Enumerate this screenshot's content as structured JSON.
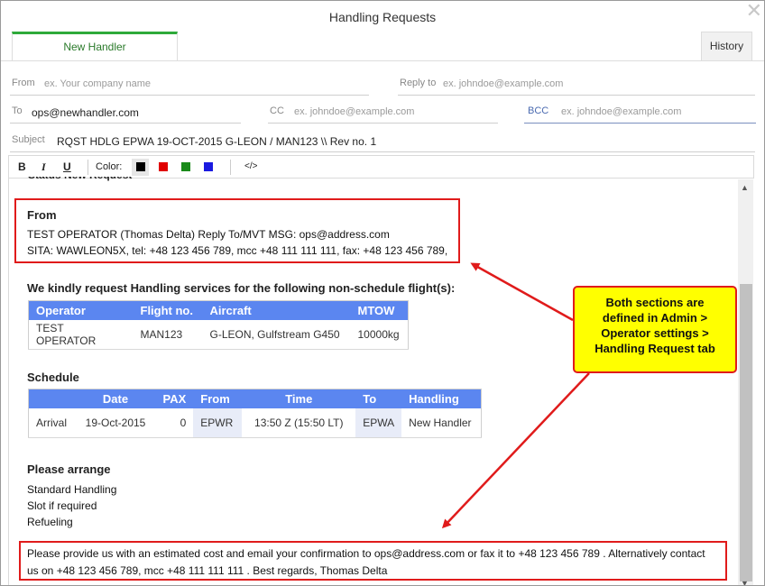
{
  "window": {
    "title": "Handling Requests"
  },
  "tabs": {
    "new_handler": "New Handler",
    "history": "History"
  },
  "form": {
    "from": {
      "label": "From",
      "placeholder": "ex. Your company name"
    },
    "reply_to": {
      "label": "Reply to",
      "placeholder": "ex. johndoe@example.com"
    },
    "to": {
      "label": "To",
      "value": "ops@newhandler.com"
    },
    "cc": {
      "label": "CC",
      "placeholder": "ex. johndoe@example.com"
    },
    "bcc": {
      "label": "BCC",
      "placeholder": "ex. johndoe@example.com"
    },
    "subject": {
      "label": "Subject",
      "value": "RQST HDLG  EPWA 19-OCT-2015  G-LEON / MAN123 \\\\ Rev no. 1"
    }
  },
  "toolbar": {
    "bold": "B",
    "italic": "I",
    "underline": "U",
    "color_label": "Color:",
    "source": "</>",
    "colors": [
      "#000000",
      "#e00000",
      "#1a8a1a",
      "#1a1ae0"
    ]
  },
  "body": {
    "cut_line": "Status New Request",
    "from_title": "From",
    "from_line1": "TEST OPERATOR (Thomas Delta) Reply To/MVT MSG: ops@address.com",
    "from_line2": "SITA: WAWLEON5X, tel: +48 123 456 789, mcc +48 111 111 111, fax: +48 123 456 789,",
    "request_title": "We kindly request Handling services for the following non-schedule flight(s):",
    "flight_table": {
      "headers": [
        "Operator",
        "Flight no.",
        "Aircraft",
        "MTOW"
      ],
      "rows": [
        [
          "TEST OPERATOR",
          "MAN123",
          "G-LEON, Gulfstream G450",
          "10000kg"
        ]
      ]
    },
    "schedule_title": "Schedule",
    "schedule_table": {
      "headers": [
        "",
        "Date",
        "PAX",
        "From",
        "Time",
        "To",
        "Handling"
      ],
      "rows": [
        [
          "Arrival",
          "19-Oct-2015",
          "0",
          "EPWR",
          "13:50 Z (15:50 LT)",
          "EPWA",
          "New Handler"
        ]
      ]
    },
    "arrange_title": "Please arrange",
    "arrange_items": [
      "Standard Handling",
      "Slot if required",
      "Refueling"
    ],
    "footer_line1": "Please provide us with an estimated cost and email your confirmation to ops@address.com or fax it to +48 123 456 789 . Alternatively contact",
    "footer_line2": "us on +48 123 456 789, mcc +48 111 111 111 . Best regards, Thomas Delta"
  },
  "callout": {
    "lines": [
      "Both sections are",
      "defined in Admin >",
      "Operator settings >",
      "Handling Request tab"
    ]
  },
  "colors": {
    "tab_accent": "#2eaa3a",
    "table_header": "#5b86f0",
    "highlight_box": "#e01b1b",
    "callout_bg": "#ffff00"
  }
}
